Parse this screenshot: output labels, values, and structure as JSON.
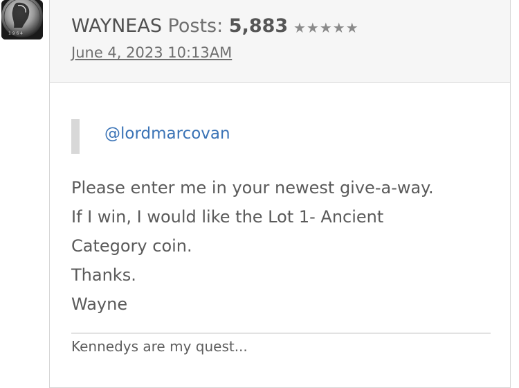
{
  "author": {
    "avatar_icon": "coin-avatar-icon",
    "name": "WAYNEAS",
    "posts_label": "Posts:",
    "posts_count": "5,883",
    "rating_stars": "★★★★★",
    "rating_value": 5,
    "rating_max": 5
  },
  "post": {
    "date": "June 4, 2023 10:13AM",
    "quote_mention": "@lordmarcovan",
    "body_lines": [
      "Please enter me in your newest give-a-way.",
      "If I win, I would like the Lot 1- Ancient",
      "Category coin.",
      "Thanks.",
      "Wayne"
    ],
    "signature": "Kennedys are my quest..."
  }
}
